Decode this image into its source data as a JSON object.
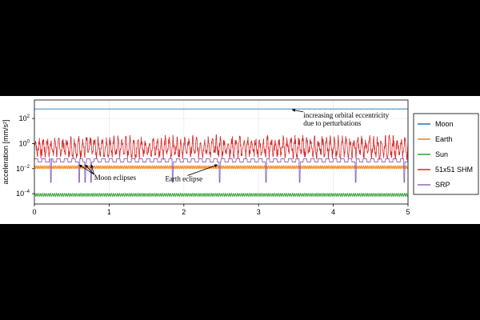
{
  "chart_data": {
    "type": "line",
    "xlabel": "",
    "ylabel": "acceleration [mm/s²]",
    "xlim": [
      0,
      5
    ],
    "ylim": [
      1.5e-05,
      3000
    ],
    "yscale": "log",
    "x_ticks": [
      "0",
      "1",
      "2",
      "3",
      "4",
      "5"
    ],
    "y_ticks": [
      {
        "value": 0.0001,
        "base": "10",
        "exp": "−4"
      },
      {
        "value": 0.01,
        "base": "10",
        "exp": "−2"
      },
      {
        "value": 1,
        "base": "10",
        "exp": "0"
      },
      {
        "value": 100,
        "base": "10",
        "exp": "2"
      }
    ],
    "grid": true,
    "legend_position": "right",
    "series": [
      {
        "name": "Moon",
        "color": "#1f77b4",
        "level": 580,
        "osc": 0.012,
        "cycles": 0,
        "phase_start": 3.45
      },
      {
        "name": "Earth",
        "color": "#ff7f0e",
        "level": 0.013,
        "osc": 0.12,
        "cycles": 200
      },
      {
        "name": "Sun",
        "color": "#2ca02c",
        "level": 8e-05,
        "osc": 0.12,
        "cycles": 190
      },
      {
        "name": "51x51 SHM",
        "color": "#d62728",
        "level": 0.5,
        "osc": 0.6,
        "cycles": 95
      },
      {
        "name": "SRP",
        "color": "#9467bd",
        "level": 0.045,
        "dips_at": [
          0.22,
          0.6,
          0.68,
          0.76,
          1.85,
          2.48,
          3.1,
          3.55,
          4.3,
          4.95
        ],
        "dip_depth": 0.0008
      }
    ],
    "annotations": [
      {
        "lines": [
          "increasing orbital eccentricity",
          "due to perturbations"
        ],
        "x": 3.6,
        "y": 120,
        "arrow_to": [
          3.45,
          500
        ]
      },
      {
        "lines": [
          "Moon eclipses"
        ],
        "x": 0.8,
        "y": 0.0012,
        "arrow_to": [
          [
            0.6,
            0.02
          ],
          [
            0.68,
            0.02
          ],
          [
            0.76,
            0.02
          ]
        ]
      },
      {
        "lines": [
          "Earth eclipse"
        ],
        "x": 1.75,
        "y": 0.001,
        "arrow_to": [
          2.45,
          0.02
        ]
      }
    ]
  }
}
